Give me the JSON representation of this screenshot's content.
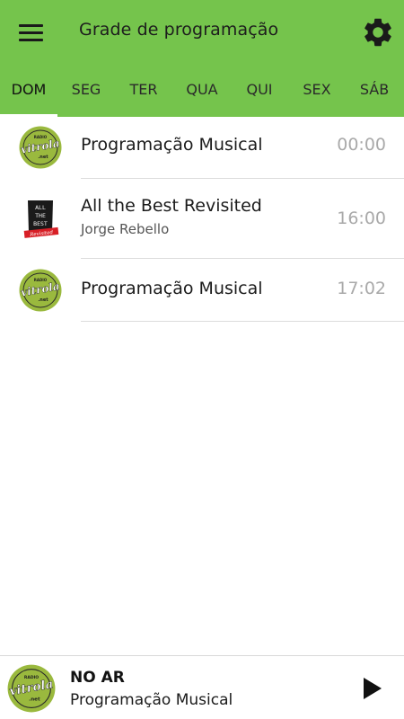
{
  "header": {
    "title": "Grade de programação",
    "menu_icon": "hamburger-menu-icon",
    "settings_icon": "gear-icon"
  },
  "tabs": [
    {
      "label": "DOM",
      "active": true
    },
    {
      "label": "SEG",
      "active": false
    },
    {
      "label": "TER",
      "active": false
    },
    {
      "label": "QUA",
      "active": false
    },
    {
      "label": "QUI",
      "active": false
    },
    {
      "label": "SEX",
      "active": false
    },
    {
      "label": "SÁB",
      "active": false
    }
  ],
  "schedule": [
    {
      "name": "Programação Musical",
      "host": "",
      "time": "00:00",
      "logo": "vitrola-logo"
    },
    {
      "name": "All the Best Revisited",
      "host": "Jorge Rebello",
      "time": "16:00",
      "logo": "all-the-best-logo"
    },
    {
      "name": "Programação Musical",
      "host": "",
      "time": "17:02",
      "logo": "vitrola-logo"
    }
  ],
  "player": {
    "label": "NO AR",
    "now_playing": "Programação Musical",
    "play_icon": "play-icon",
    "logo": "vitrola-logo"
  },
  "logos": {
    "vitrola": {
      "radio": "RADIO",
      "name": "vitrola",
      "suffix": ".net"
    },
    "all_the_best": {
      "line1": "ALL",
      "line2": "THE",
      "line3": "BEST",
      "ribbon": "Revisited"
    }
  },
  "colors": {
    "app_bar": "#75c44c",
    "logo_green": "#9ab93e",
    "time_text": "#a9a9a9",
    "divider": "#dcdcdc"
  }
}
